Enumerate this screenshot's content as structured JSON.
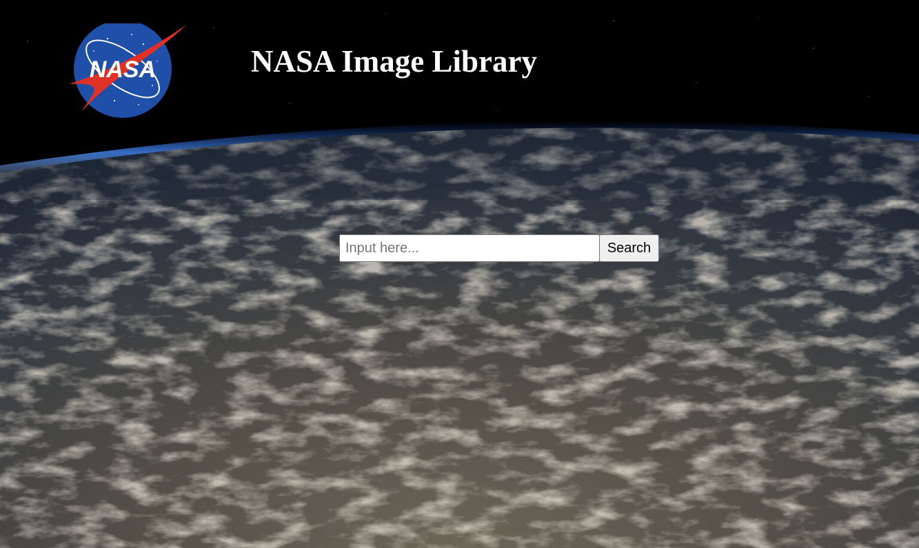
{
  "header": {
    "logo_text": "NASA",
    "title": "NASA Image Library"
  },
  "search": {
    "placeholder": "Input here...",
    "value": "",
    "button_label": "Search"
  },
  "background": {
    "subject": "earth-from-orbit"
  }
}
